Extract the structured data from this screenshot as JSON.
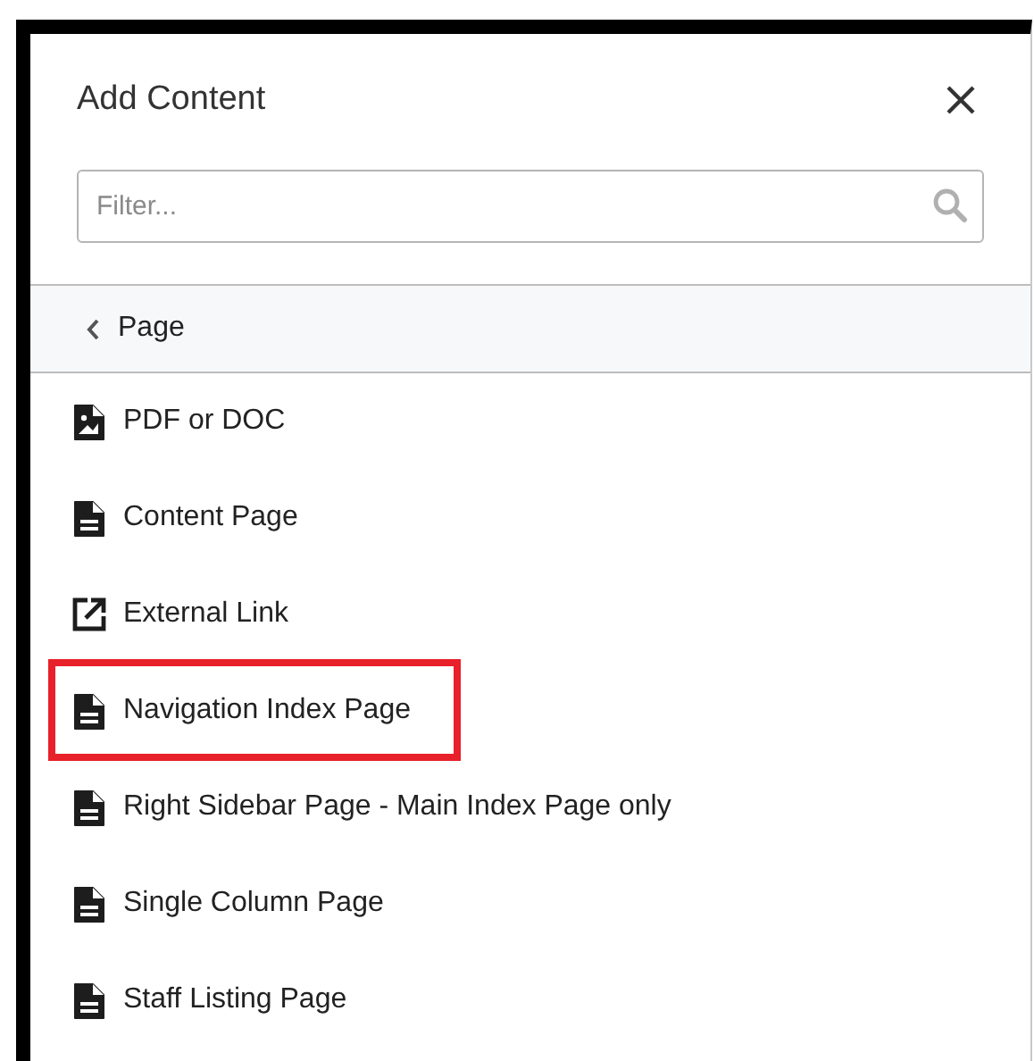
{
  "panel": {
    "title": "Add Content"
  },
  "filter": {
    "placeholder": "Filter..."
  },
  "back": {
    "label": "Page"
  },
  "items": [
    {
      "kind": "pdf",
      "label": "PDF or DOC",
      "highlighted": false
    },
    {
      "kind": "page",
      "label": "Content Page",
      "highlighted": false
    },
    {
      "kind": "link",
      "label": "External Link",
      "highlighted": false
    },
    {
      "kind": "page",
      "label": "Navigation Index Page",
      "highlighted": true
    },
    {
      "kind": "page",
      "label": "Right Sidebar Page - Main Index Page only",
      "highlighted": false
    },
    {
      "kind": "page",
      "label": "Single Column Page",
      "highlighted": false
    },
    {
      "kind": "page",
      "label": "Staff Listing Page",
      "highlighted": false
    }
  ]
}
